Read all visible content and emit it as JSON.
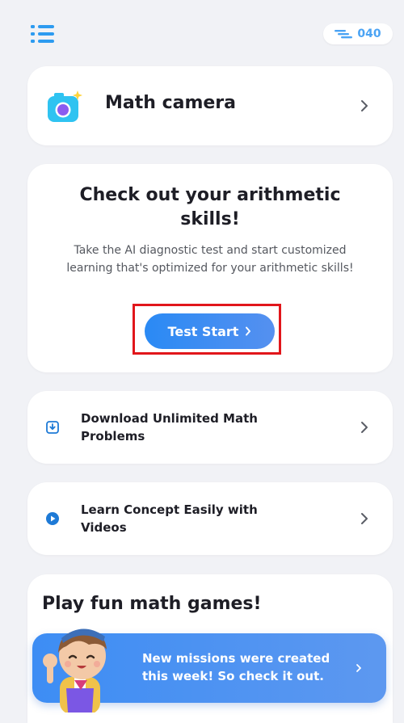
{
  "header": {
    "coin_count": "040",
    "coin_icon": "coin-icon",
    "menu_icon": "list-menu-icon"
  },
  "camera_card": {
    "label": "Math camera",
    "icon": "camera-icon"
  },
  "diagnostic_card": {
    "title": "Check out your arithmetic skills!",
    "description": "Take the AI diagnostic test and start customized learning that's optimized for your arithmetic skills!",
    "button_label": "Test Start"
  },
  "download_card": {
    "label": "Download Unlimited Math Problems",
    "icon": "download-icon"
  },
  "video_card": {
    "label": "Learn Concept Easily with Videos",
    "icon": "play-icon"
  },
  "games_card": {
    "title": "Play fun math games!"
  },
  "mission_banner": {
    "text": "New missions were created this week! So check it out."
  },
  "colors": {
    "accent": "#2a8af4",
    "highlight_box": "#e1161b",
    "banner": "#4b92f2",
    "background": "#f1f2f6"
  }
}
